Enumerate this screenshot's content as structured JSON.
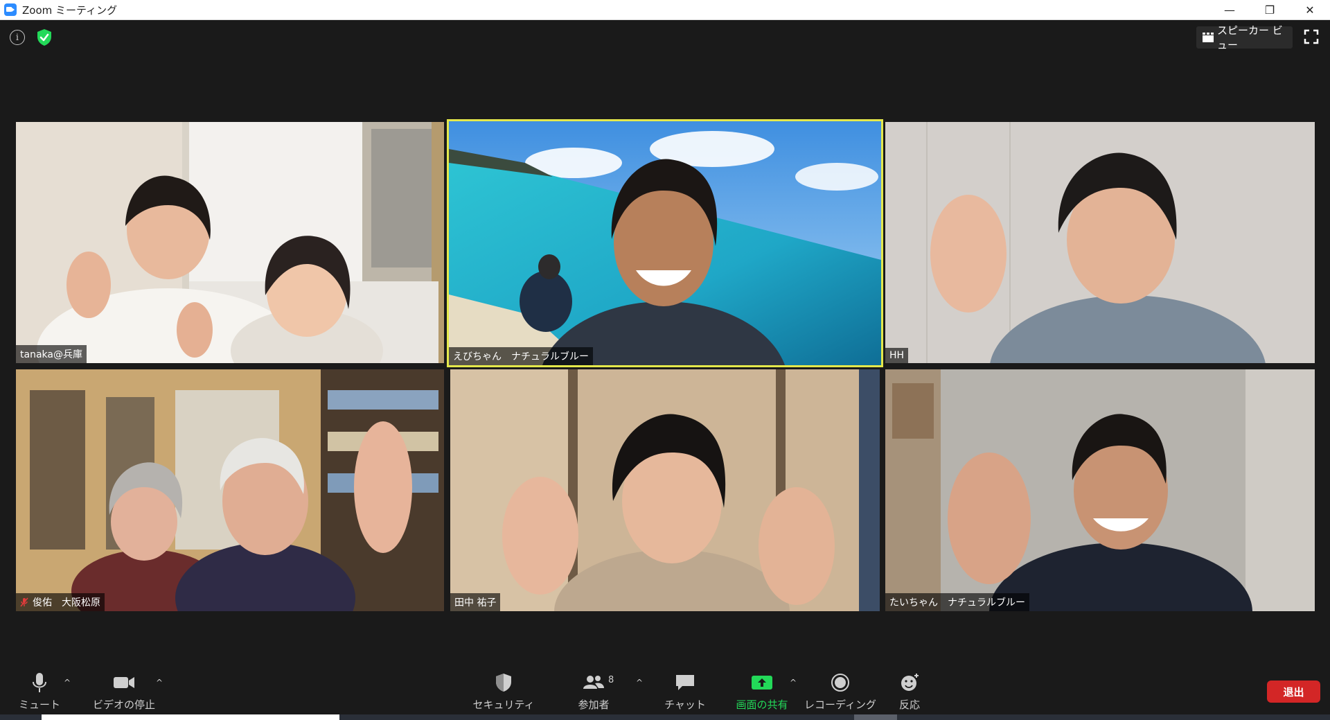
{
  "window": {
    "title": "Zoom ミーティング",
    "minimize": "—",
    "restore": "❐",
    "close": "✕"
  },
  "top_overlay": {
    "info": "i",
    "speaker_view_label": "スピーカー ビュー"
  },
  "participants": [
    {
      "name": "tanaka@兵庫",
      "muted": false
    },
    {
      "name": "えびちゃん　ナチュラルブルー",
      "muted": false,
      "active_speaker": true
    },
    {
      "name": "HH",
      "muted": false
    },
    {
      "name": "俊佑　大阪松原",
      "muted": true
    },
    {
      "name": "田中 祐子",
      "muted": false
    },
    {
      "name": "たいちゃん　ナチュラルブルー",
      "muted": false
    }
  ],
  "toolbar": {
    "mute": "ミュート",
    "stop_video": "ビデオの停止",
    "security": "セキュリティ",
    "participants": "参加者",
    "participants_count": "8",
    "chat": "チャット",
    "share_screen": "画面の共有",
    "recording": "レコーディング",
    "reactions": "反応",
    "leave": "退出",
    "caret": "^"
  },
  "colors": {
    "accent_green": "#23D959",
    "leave_red": "#D32626",
    "active_speaker_border": "#E4E84B",
    "zoom_blue": "#2D8CFF"
  }
}
